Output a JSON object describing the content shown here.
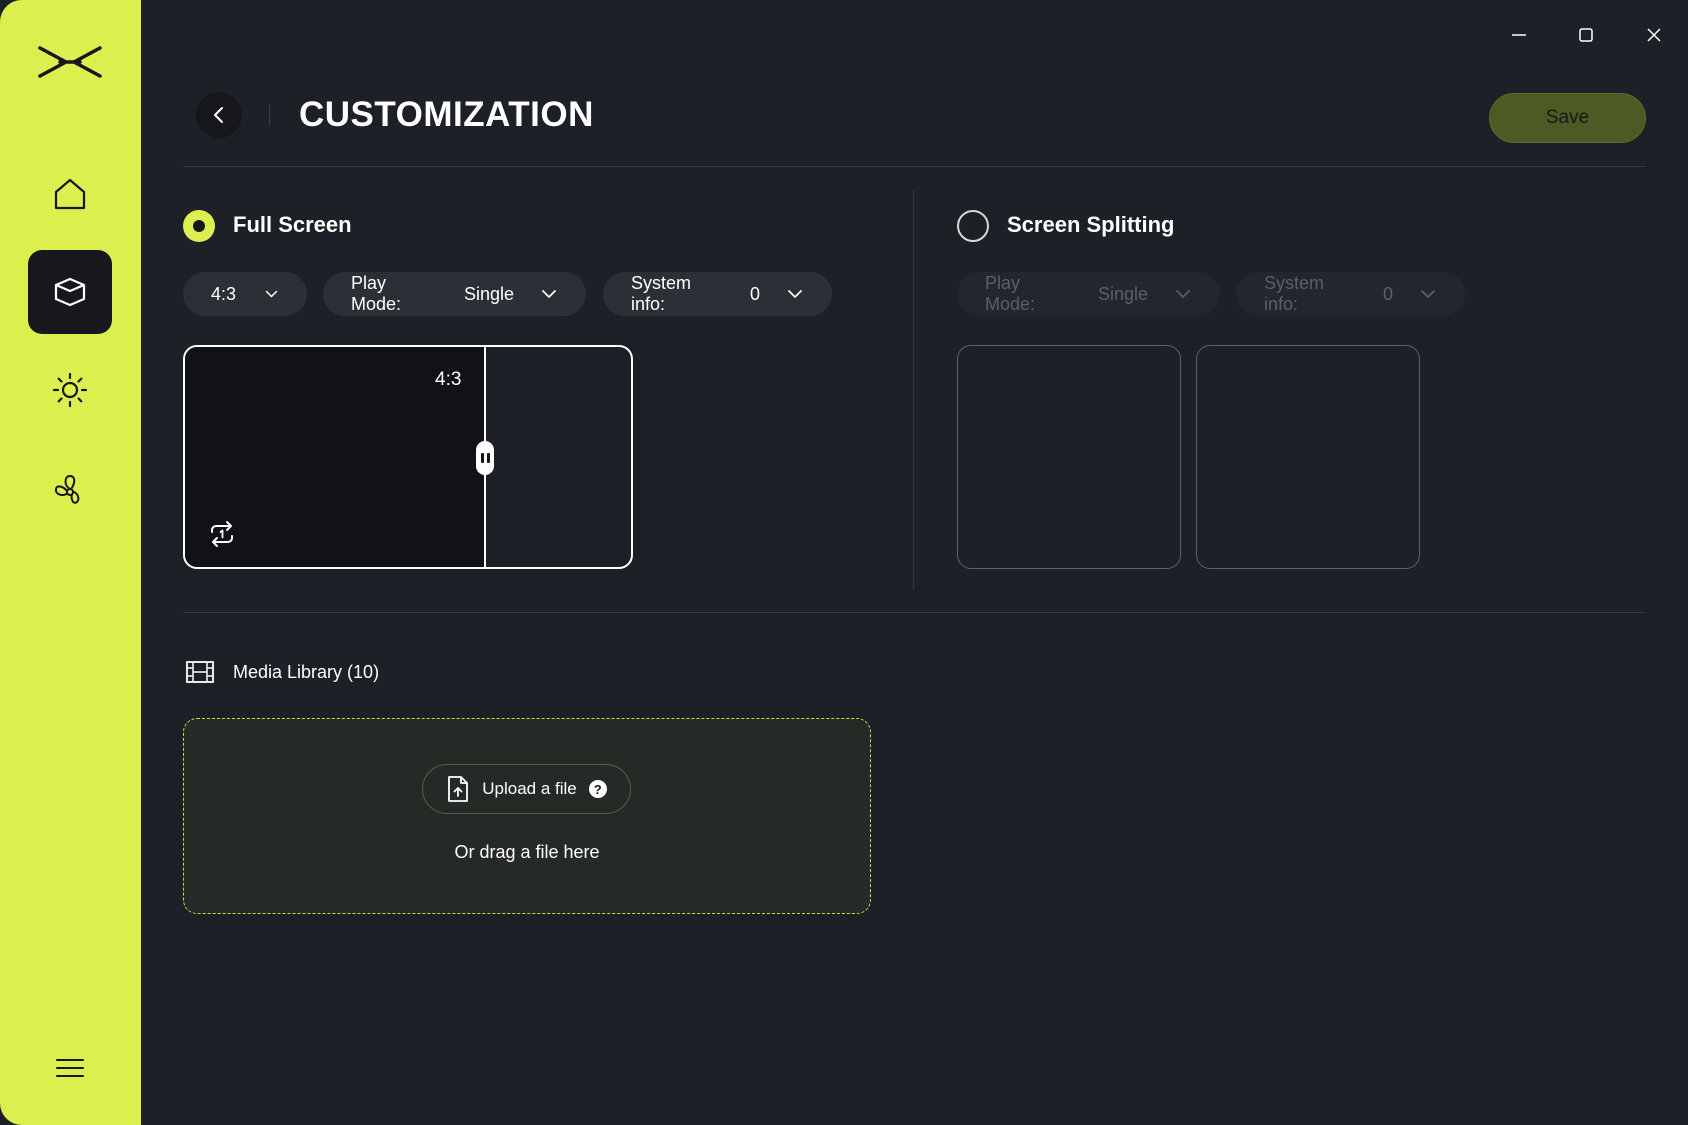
{
  "window": {
    "minimize_icon": "minimize-icon",
    "maximize_icon": "maximize-icon",
    "close_icon": "close-icon"
  },
  "sidebar": {
    "logo": "app-logo",
    "items": [
      {
        "id": "home",
        "icon": "home-icon",
        "active": false
      },
      {
        "id": "customization",
        "icon": "box-icon",
        "active": true
      },
      {
        "id": "brightness",
        "icon": "sun-icon",
        "active": false
      },
      {
        "id": "fan",
        "icon": "fan-icon",
        "active": false
      }
    ],
    "menu_icon": "hamburger-menu-icon"
  },
  "header": {
    "title": "CUSTOMIZATION",
    "save_label": "Save"
  },
  "full_screen": {
    "label": "Full Screen",
    "selected": true,
    "aspect_ratio": "4:3",
    "play_mode_label": "Play Mode:",
    "play_mode_value": "Single",
    "system_info_label": "System info:",
    "system_info_value": "0",
    "preview_ratio_label": "4:3"
  },
  "screen_splitting": {
    "label": "Screen Splitting",
    "selected": false,
    "play_mode_label": "Play Mode:",
    "play_mode_value": "Single",
    "system_info_label": "System info:",
    "system_info_value": "0"
  },
  "media_library": {
    "title": "Media Library (10)",
    "upload_label": "Upload a file",
    "help_glyph": "?",
    "drag_text": "Or drag a file here"
  },
  "colors": {
    "accent": "#dbf04f",
    "background": "#1d2026",
    "save_button": "#4d5a23"
  }
}
